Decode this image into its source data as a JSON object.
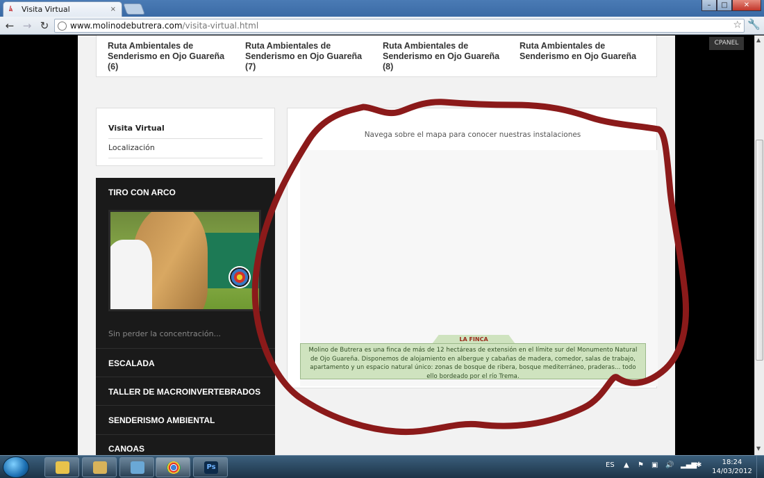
{
  "browser": {
    "tab_title": "Visita Virtual",
    "tab_close": "×",
    "url_host": "www.molinodebutrera.com",
    "url_path": "/visita-virtual.html",
    "back": "←",
    "forward": "→",
    "reload": "↻",
    "star": "☆",
    "wrench": "🔧",
    "minimize": "–",
    "maximize": "□",
    "close": "✕"
  },
  "top_routes": [
    {
      "label": "Ruta Ambientales de Senderismo en Ojo Guareña (6)"
    },
    {
      "label": "Ruta Ambientales de Senderismo en Ojo Guareña (7)"
    },
    {
      "label": "Ruta Ambientales de Senderismo en Ojo Guareña (8)"
    },
    {
      "label": "Ruta Ambientales de Senderismo en Ojo Guareña"
    }
  ],
  "cpanel": "CPANEL",
  "subnav": {
    "items": [
      {
        "label": "Visita Virtual"
      },
      {
        "label": "Localización"
      }
    ]
  },
  "sidebar": {
    "heading": "TIRO CON ARCO",
    "caption": "Sin perder la concentración...",
    "links": [
      {
        "label": "ESCALADA"
      },
      {
        "label": "TALLER DE MACROINVERTEBRADOS"
      },
      {
        "label": "SENDERISMO AMBIENTAL"
      },
      {
        "label": "CANOAS"
      }
    ]
  },
  "map": {
    "intro": "Navega sobre el mapa para conocer nuestras instalaciones",
    "finca_title": "LA FINCA",
    "finca_text": "Molino de Butrera es una finca de más de 12 hectáreas de extensión en el límite sur del Monumento Natural de Ojo Guareña. Disponemos de alojamiento en albergue y cabañas de madera, comedor, salas de trabajo, apartamento y un espacio natural único: zonas de bosque de ribera, bosque mediterráneo, praderas... todo ello bordeado por el río Trema."
  },
  "annotation_color": "#8b1a1a",
  "taskbar": {
    "apps": [
      {
        "icon": "folder-open-icon"
      },
      {
        "icon": "explorer-icon"
      },
      {
        "icon": "notes-icon"
      },
      {
        "icon": "chrome-icon"
      },
      {
        "icon": "photoshop-icon",
        "label": "Ps"
      }
    ],
    "lang": "ES",
    "time": "18:24",
    "date": "14/03/2012"
  }
}
